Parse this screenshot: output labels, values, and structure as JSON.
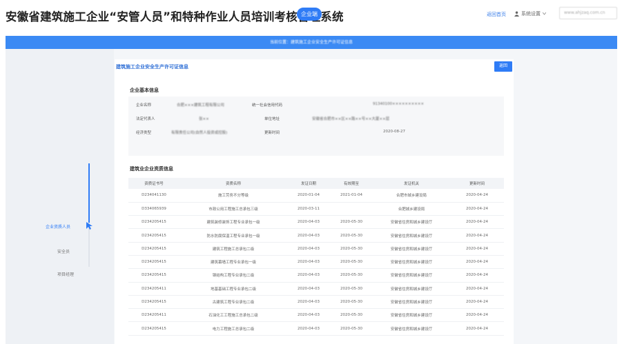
{
  "header": {
    "title": "安徽省建筑施工企业“安管人员”和特种作业人员培训考核管理系统",
    "badge": "企业端",
    "link": "返回首页",
    "user": "系统设置",
    "search": "www.ahjzaq.com.cn"
  },
  "breadcrumb": "当前位置：建筑施工企业安全生产许可证信息",
  "sidebar": {
    "items": [
      {
        "label": "企业资质人员"
      },
      {
        "label": "安全员"
      },
      {
        "label": "项目经理"
      }
    ]
  },
  "main": {
    "title": "建筑施工企业安全生产许可证信息",
    "back_label": "返回",
    "basic_section": "企业基本信息",
    "basic_info": {
      "company_name_label": "企业名称",
      "company_name_value": "合肥×××建筑工程有限公司",
      "credit_code_label": "统一社会信用代码",
      "credit_code_value": "91340100××××××××××",
      "legal_rep_label": "法定代表人",
      "legal_rep_value": "张××",
      "address_label": "单位地址",
      "address_value": "安徽省合肥市××区××路××号××大厦××层",
      "econ_type_label": "经济类型",
      "econ_type_value": "有限责任公司(自然人投资或控股)",
      "date_label": "更新时间",
      "date_value": "2020-08-27"
    },
    "qual_section": "建筑业企业资质信息",
    "table": {
      "columns": [
        "资质证书号",
        "资质名称",
        "发证日期",
        "有效期至",
        "发证机关",
        "更新时间"
      ],
      "rows": [
        [
          "D234041130",
          "施工劳务不分等级",
          "2020-01-04",
          "2021-01-04",
          "合肥市城乡建设局",
          "2020-04-24"
        ],
        [
          "D334065939",
          "市政公用工程施工总承包三级",
          "2020-03-11",
          "",
          "合肥城乡建设局",
          "2020-04-24"
        ],
        [
          "D234205415",
          "建筑装修装饰工程专业承包一级",
          "2020-04-03",
          "2020-05-30",
          "安徽省住房和城乡建设厅",
          "2020-04-24"
        ],
        [
          "D234205415",
          "防水防腐保温工程专业承包一级",
          "2020-04-03",
          "2020-05-30",
          "安徽省住房和城乡建设厅",
          "2020-04-24"
        ],
        [
          "D234205415",
          "建筑工程施工总承包二级",
          "2020-04-03",
          "2020-05-30",
          "安徽省住房和城乡建设厅",
          "2020-04-24"
        ],
        [
          "D234205415",
          "建筑幕墙工程专业承包一级",
          "2020-04-03",
          "2020-05-30",
          "安徽省住房和城乡建设厅",
          "2020-04-24"
        ],
        [
          "D234205415",
          "钢结构工程专业承包二级",
          "2020-04-03",
          "2020-05-30",
          "安徽省住房和城乡建设厅",
          "2020-04-24"
        ],
        [
          "D234205411",
          "地基基础工程专业承包二级",
          "2020-04-03",
          "2020-05-30",
          "安徽省住房和城乡建设厅",
          "2020-04-24"
        ],
        [
          "D234205415",
          "古建筑工程专业承包二级",
          "2020-04-03",
          "2020-05-30",
          "安徽省住房和城乡建设厅",
          "2020-04-24"
        ],
        [
          "D234205411",
          "石油化工工程施工总承包二级",
          "2020-04-03",
          "2020-05-30",
          "安徽省住房和城乡建设厅",
          "2020-04-24"
        ],
        [
          "D234205415",
          "电力工程施工总承包二级",
          "2020-04-03",
          "2020-05-30",
          "安徽省住房和城乡建设厅",
          "2020-04-24"
        ]
      ]
    }
  },
  "colors": {
    "accent": "#2f7cf6",
    "bar": "#3b8af4"
  }
}
